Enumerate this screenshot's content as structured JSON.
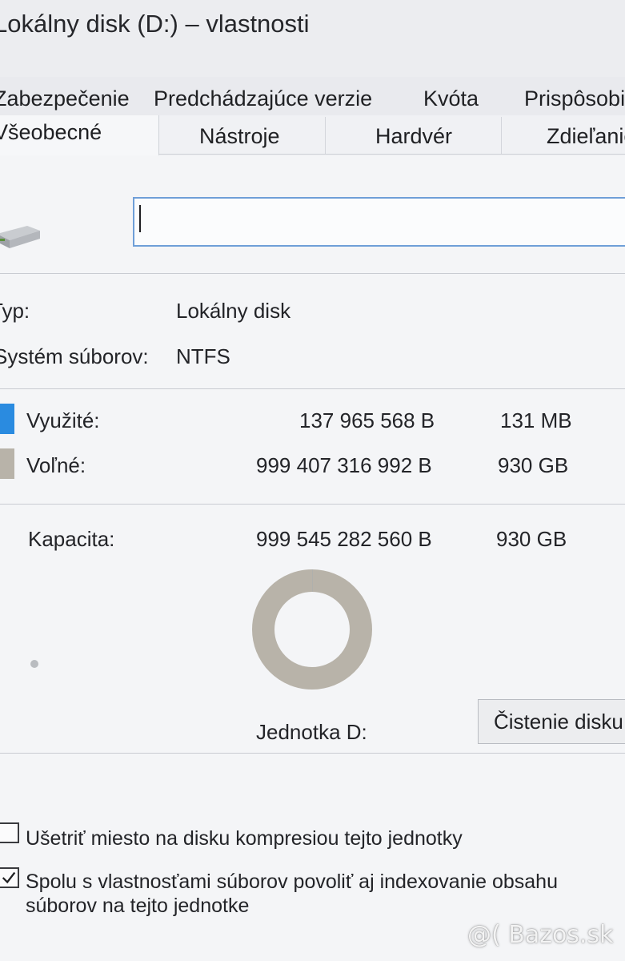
{
  "window": {
    "title": "Lokálny disk (D:) – vlastnosti"
  },
  "tabs": {
    "row1": [
      "Zabezpečenie",
      "Predchádzajúce verzie",
      "Kvóta",
      "Prispôsobiť"
    ],
    "row2": [
      "Všeobecné",
      "Nástroje",
      "Hardvér",
      "Zdieľanie"
    ],
    "active": "Všeobecné"
  },
  "general": {
    "name_value": "",
    "type_label": "Typ:",
    "type_value": "Lokálny disk",
    "fs_label": "Systém súborov:",
    "fs_value": "NTFS",
    "used_label": "Využité:",
    "used_bytes": "137 965 568 B",
    "used_size": "131 MB",
    "free_label": "Voľné:",
    "free_bytes": "999 407 316 992 B",
    "free_size": "930 GB",
    "capacity_label": "Kapacita:",
    "capacity_bytes": "999 545 282 560 B",
    "capacity_size": "930 GB",
    "drive_label": "Jednotka D:",
    "cleanup_button": "Čistenie disku",
    "used_fraction": 0.000138,
    "colors": {
      "used": "#2a8be0",
      "free": "#b8b3a9"
    },
    "compress_label": "Ušetriť miesto na disku kompresiou tejto jednotky",
    "compress_checked": false,
    "index_label_line1": "Spolu s vlastnosťami súborov povoliť aj indexovanie obsahu",
    "index_label_line2": "súborov na tejto jednotke",
    "index_checked": true
  },
  "watermark": "@( Bazos.sk"
}
